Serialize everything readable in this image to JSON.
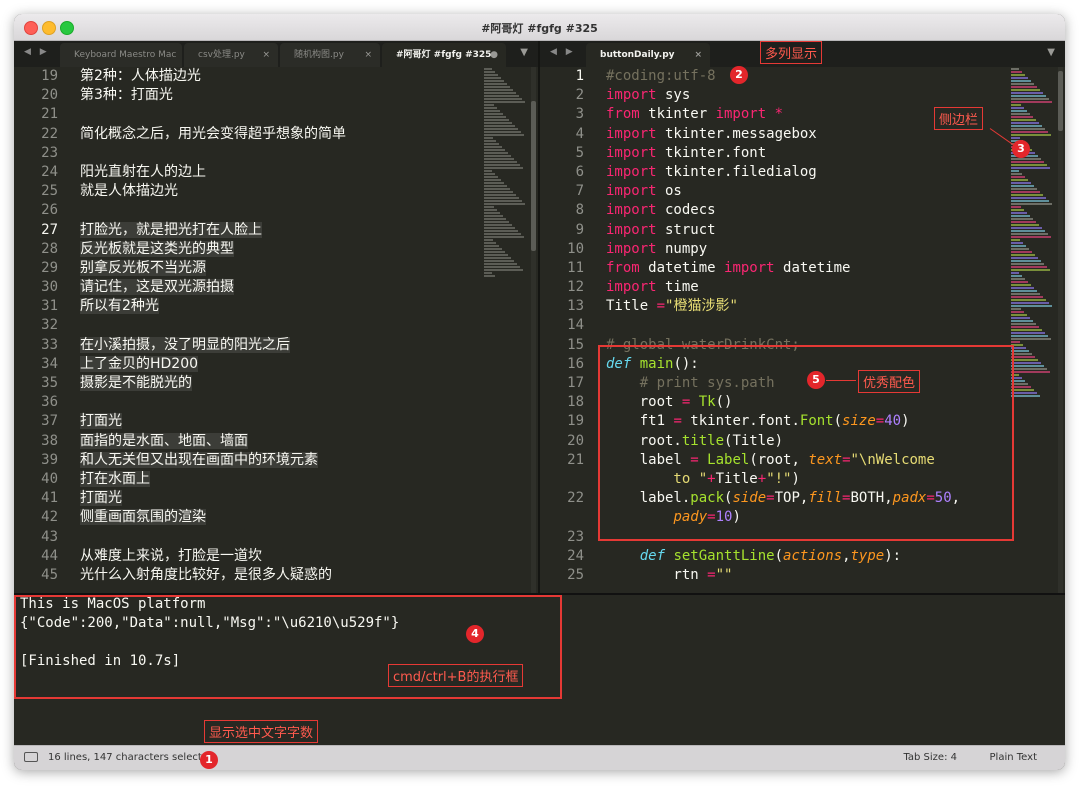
{
  "window": {
    "title": "#阿哥灯 #fgfg #325"
  },
  "left_tabs": [
    {
      "label": "Keyboard Maestro Mac",
      "close": ""
    },
    {
      "label": "csv处理.py",
      "close": "×"
    },
    {
      "label": "随机构图.py",
      "close": "×"
    },
    {
      "label": "#阿哥灯 #fgfg #325",
      "close": "●"
    }
  ],
  "right_tabs": [
    {
      "label": "buttonDaily.py",
      "close": "×"
    }
  ],
  "nav_arrows": "◀ ▶",
  "dropdown_icon": "▼",
  "left_editor": {
    "line_numbers": [
      "19",
      "20",
      "21",
      "22",
      "23",
      "24",
      "25",
      "26",
      "27",
      "28",
      "29",
      "30",
      "31",
      "32",
      "33",
      "34",
      "35",
      "36",
      "37",
      "38",
      "39",
      "40",
      "41",
      "42",
      "43",
      "44",
      "45"
    ],
    "lines": [
      "第2种：人体描边光",
      "第3种：打面光",
      "",
      "简化概念之后，用光会变得超乎想象的简单",
      "",
      "阳光直射在人的边上",
      "就是人体描边光",
      "",
      "打脸光，就是把光打在人脸上",
      "反光板就是这类光的典型",
      "别拿反光板不当光源",
      "请记住，这是双光源拍摄",
      "所以有2种光",
      "",
      "在小溪拍摄，没了明显的阳光之后",
      "上了金贝的HD200",
      "摄影是不能脱光的",
      "",
      "打面光",
      "面指的是水面、地面、墙面",
      "和人无关但又出现在画面中的环境元素",
      "打在水面上",
      "打面光",
      "侧重画面氛围的渲染",
      "",
      "从难度上来说，打脸是一道坎",
      "光什么入射角度比较好，是很多人疑惑的"
    ]
  },
  "right_editor": {
    "line_numbers": [
      "1",
      "2",
      "3",
      "4",
      "5",
      "6",
      "7",
      "8",
      "9",
      "10",
      "11",
      "12",
      "13",
      "14",
      "15",
      "16",
      "17",
      "18",
      "19",
      "20",
      "21",
      "",
      "22",
      "",
      "23",
      "24",
      "25"
    ]
  },
  "console": {
    "lines": [
      "This is MacOS platform",
      "{\"Code\":200,\"Data\":null,\"Msg\":\"\\u6210\\u529f\"}",
      "",
      "[Finished in 10.7s]"
    ]
  },
  "status_bar": {
    "selection": "16 lines, 147 characters selected",
    "tab_size": "Tab Size: 4",
    "syntax": "Plain Text"
  },
  "annotations": {
    "label_1": "显示选中文字字数",
    "label_2": "多列显示",
    "label_3": "侧边栏",
    "label_4": "cmd/ctrl+B的执行框",
    "label_5": "优秀配色",
    "badges": [
      "1",
      "2",
      "3",
      "4",
      "5"
    ],
    "color": "#e53935"
  },
  "theme": {
    "background": "#272822",
    "keyword": "#f92672",
    "string": "#e6db74",
    "comment": "#75715e",
    "number": "#ae81ff",
    "function": "#a6e22e",
    "parameter": "#fd971f",
    "storage": "#66d9ef"
  }
}
